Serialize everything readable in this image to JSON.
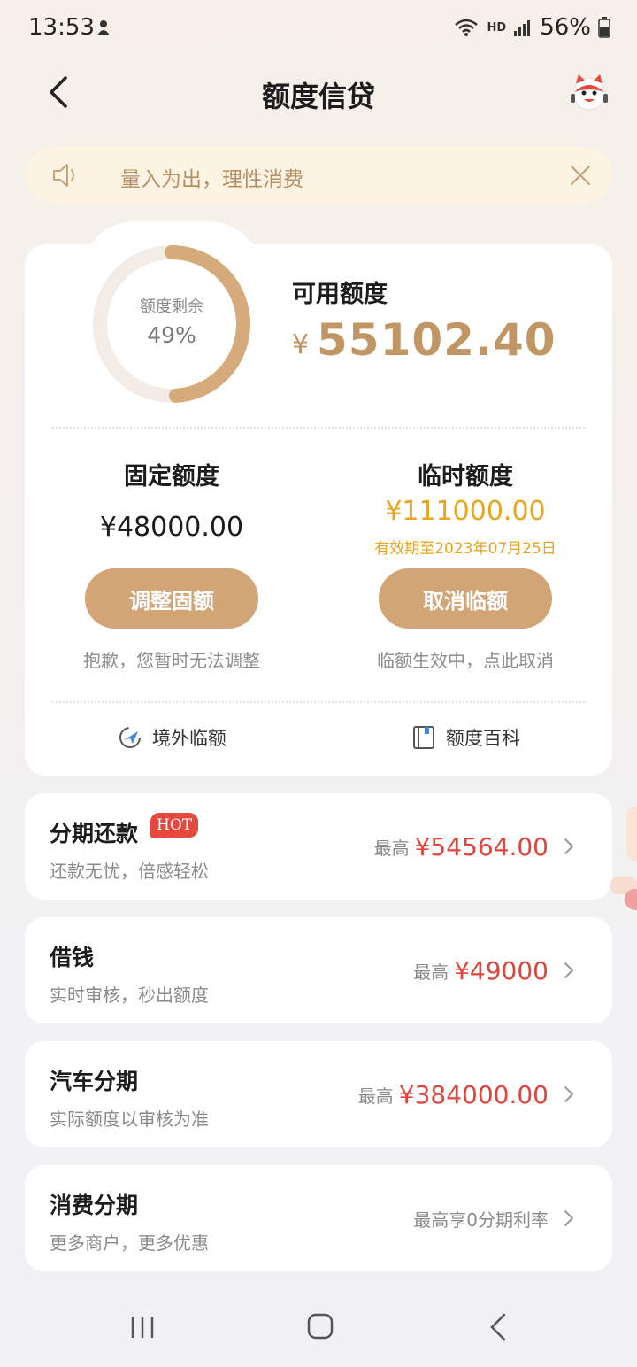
{
  "status_bar": {
    "time": "13:53",
    "network": "HD",
    "battery": "56%"
  },
  "header": {
    "title": "额度信贷",
    "back_icon": "chevron-left-icon",
    "mascot_icon": "mascot-icon"
  },
  "notice": {
    "text": "量入为出，理性消费",
    "icon": "speaker-icon",
    "close_icon": "close-icon"
  },
  "summary": {
    "gauge_label": "额度剩余",
    "gauge_percent": "49%",
    "gauge_fraction": 0.49,
    "available_label": "可用额度",
    "currency": "¥",
    "available_amount": "55102.40",
    "fixed": {
      "title": "固定额度",
      "amount": "¥48000.00",
      "button": "调整固额",
      "note": "抱歉，您暂时无法调整"
    },
    "temp": {
      "title": "临时额度",
      "amount": "¥111000.00",
      "expiry": "有效期至2023年07月25日",
      "button": "取消临额",
      "note": "临额生效中，点此取消"
    },
    "links": {
      "overseas": "境外临额",
      "wiki": "额度百科"
    }
  },
  "features": [
    {
      "title": "分期还款",
      "badge": "HOT",
      "subtitle": "还款无忧，倍感轻松",
      "prefix": "最高",
      "amount": "¥54564.00"
    },
    {
      "title": "借钱",
      "subtitle": "实时审核，秒出额度",
      "prefix": "最高",
      "amount": "¥49000"
    },
    {
      "title": "汽车分期",
      "subtitle": "实际额度以审核为准",
      "prefix": "最高",
      "amount": "¥384000.00"
    },
    {
      "title": "消费分期",
      "subtitle": "更多商户，更多优惠",
      "prefix": "最高享0分期利率",
      "amount": ""
    }
  ],
  "colors": {
    "accent": "#c09665",
    "button": "#d1a575",
    "temp": "#e8a51f",
    "red": "#e0443c"
  }
}
